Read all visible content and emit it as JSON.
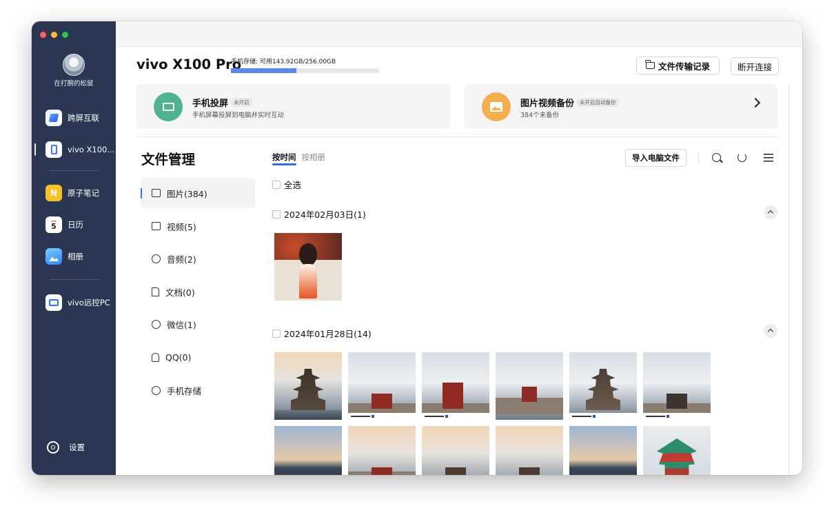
{
  "sidebar": {
    "username": "在打腕的松鼠",
    "items": [
      {
        "label": "跨屏互联",
        "icon": "cross-screen-icon"
      },
      {
        "label": "vivo X100...",
        "icon": "phone-icon"
      },
      {
        "label": "原子笔记",
        "icon": "atom-notes-icon"
      },
      {
        "label": "日历",
        "icon": "calendar-icon",
        "icon_text": "5"
      },
      {
        "label": "相册",
        "icon": "album-icon"
      },
      {
        "label": "vivo远控PC",
        "icon": "remote-pc-icon"
      }
    ],
    "settings_label": "设置"
  },
  "header": {
    "device_name": "vivo X100 Pro",
    "storage_text": "手机存储: 可用143.92GB/256.00GB",
    "storage_used_fraction": 0.44,
    "transfer_records_label": "文件传输记录",
    "disconnect_label": "断开连接"
  },
  "cards": {
    "mirror": {
      "title": "手机投屏",
      "tag": "未开启",
      "subtitle": "手机屏幕投屏到电脑并实时互动"
    },
    "backup": {
      "title": "图片视频备份",
      "tag": "未开启自动备份",
      "subtitle": "384个未备份"
    }
  },
  "files": {
    "title": "文件管理",
    "categories": [
      {
        "label": "图片(384)",
        "icon": "image-icon"
      },
      {
        "label": "视频(5)",
        "icon": "video-icon"
      },
      {
        "label": "音频(2)",
        "icon": "audio-icon"
      },
      {
        "label": "文档(0)",
        "icon": "document-icon"
      },
      {
        "label": "微信(1)",
        "icon": "wechat-icon"
      },
      {
        "label": "QQ(0)",
        "icon": "qq-icon"
      },
      {
        "label": "手机存储",
        "icon": "storage-icon"
      }
    ],
    "tabs": {
      "by_time": "按时间",
      "by_album": "按相册"
    },
    "import_label": "导入电脑文件",
    "select_all_label": "全选",
    "groups": [
      {
        "date_label": "2024年02月03日(1)"
      },
      {
        "date_label": "2024年01月28日(14)"
      }
    ]
  },
  "colors": {
    "sidebar_bg": "#2b3652",
    "accent": "#2f6bff",
    "mirror_icon": "#4fb48e",
    "backup_icon": "#f4ae4e"
  }
}
